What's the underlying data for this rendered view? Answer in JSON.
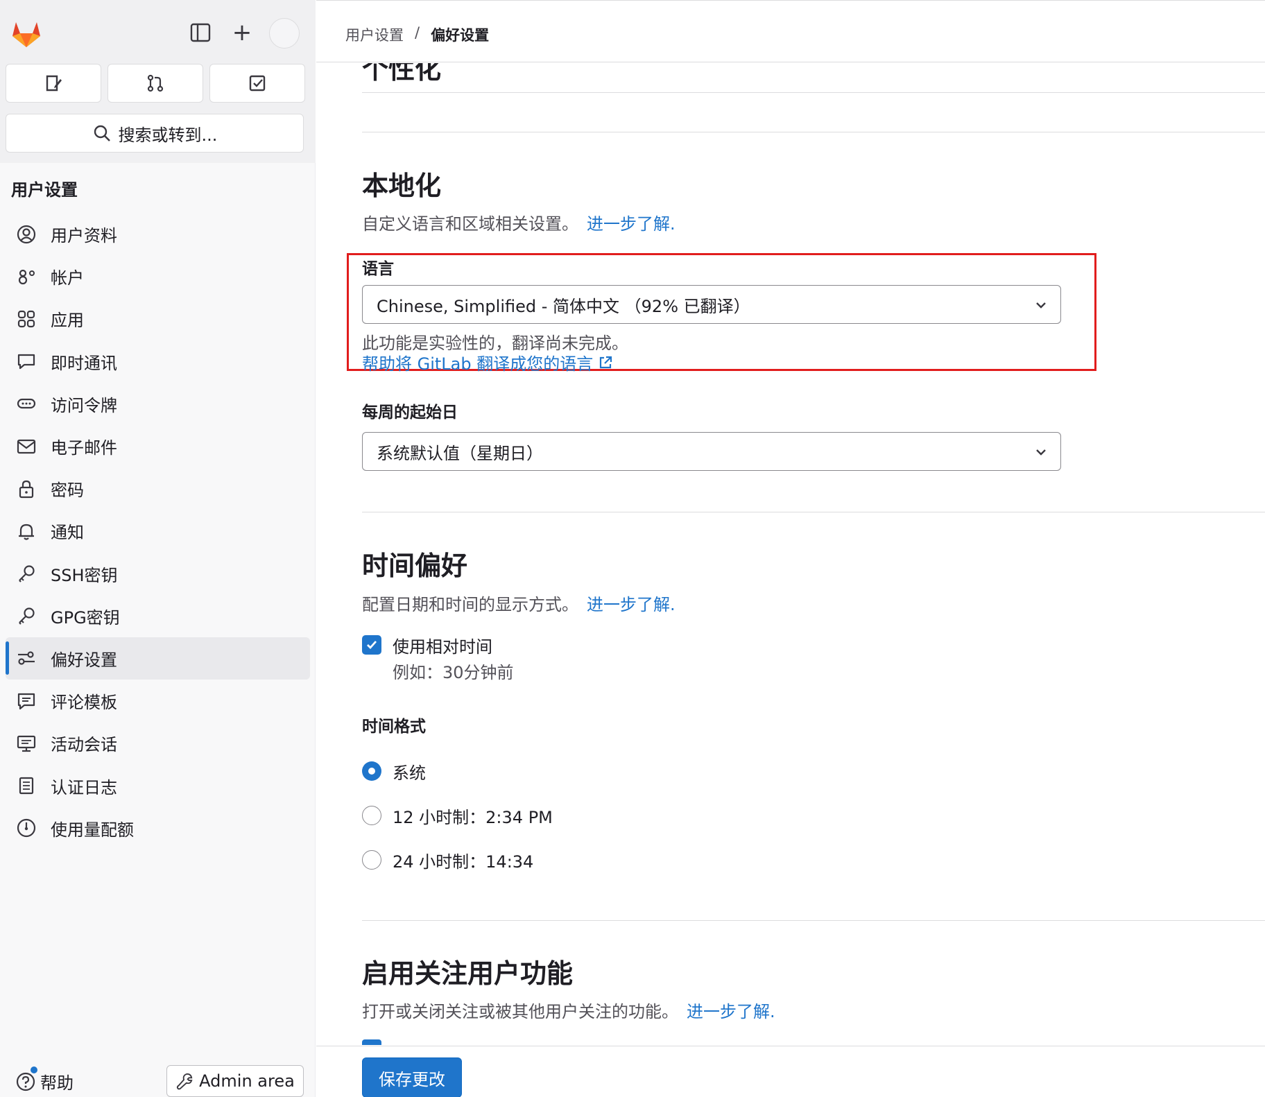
{
  "sidebar": {
    "search_label": "搜索或转到...",
    "section_title": "用户设置",
    "items": [
      {
        "label": "用户资料",
        "icon": "profile-icon"
      },
      {
        "label": "帐户",
        "icon": "account-icon"
      },
      {
        "label": "应用",
        "icon": "applications-icon"
      },
      {
        "label": "即时通讯",
        "icon": "chat-icon"
      },
      {
        "label": "访问令牌",
        "icon": "token-icon"
      },
      {
        "label": "电子邮件",
        "icon": "mail-icon"
      },
      {
        "label": "密码",
        "icon": "lock-icon"
      },
      {
        "label": "通知",
        "icon": "bell-icon"
      },
      {
        "label": "SSH密钥",
        "icon": "key-icon"
      },
      {
        "label": "GPG密钥",
        "icon": "key-icon"
      },
      {
        "label": "偏好设置",
        "icon": "preferences-icon",
        "active": true
      },
      {
        "label": "评论模板",
        "icon": "comment-icon"
      },
      {
        "label": "活动会话",
        "icon": "monitor-icon"
      },
      {
        "label": "认证日志",
        "icon": "log-icon"
      },
      {
        "label": "使用量配额",
        "icon": "gauge-icon"
      }
    ],
    "help_label": "帮助",
    "admin_label": "Admin area"
  },
  "breadcrumb": {
    "parent": "用户设置",
    "separator": "/",
    "current": "偏好设置"
  },
  "sections": {
    "personalization_title_clipped": "个性化",
    "localization": {
      "title": "本地化",
      "description": "自定义语言和区域相关设置。",
      "learn_more": "进一步了解.",
      "language_label": "语言",
      "language_value": "Chinese, Simplified - 简体中文 （92% 已翻译）",
      "language_help": "此功能是实验性的，翻译尚未完成。",
      "translate_link": "帮助将 GitLab 翻译成您的语言",
      "week_start_label": "每周的起始日",
      "week_start_value": "系统默认值（星期日）"
    },
    "time": {
      "title": "时间偏好",
      "description": "配置日期和时间的显示方式。",
      "learn_more": "进一步了解.",
      "relative_label": "使用相对时间",
      "relative_help": "例如：30分钟前",
      "relative_checked": true,
      "format_label": "时间格式",
      "formats": [
        {
          "label": "系统",
          "selected": true
        },
        {
          "label": "12 小时制：2:34 PM",
          "selected": false
        },
        {
          "label": "24 小时制：14:34",
          "selected": false
        }
      ]
    },
    "follow": {
      "title": "启用关注用户功能",
      "description": "打开或关闭关注或被其他用户关注的功能。",
      "learn_more": "进一步了解."
    }
  },
  "save_label": "保存更改",
  "colors": {
    "accent": "#1f75cb",
    "highlight_box": "#e11d1d"
  }
}
